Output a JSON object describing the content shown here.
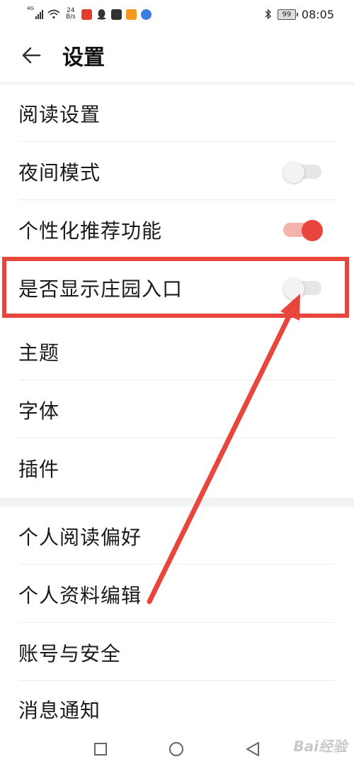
{
  "status_bar": {
    "network_type": "4G",
    "net_speed_value": "24",
    "net_speed_unit": "B/s",
    "battery": "99",
    "time": "08:05"
  },
  "header": {
    "title": "设置"
  },
  "settings": {
    "group1": [
      {
        "label": "阅读设置"
      },
      {
        "label": "夜间模式",
        "toggle": "off"
      },
      {
        "label": "个性化推荐功能",
        "toggle": "on"
      },
      {
        "label": "是否显示庄园入口",
        "toggle": "off"
      },
      {
        "label": "主题"
      },
      {
        "label": "字体"
      },
      {
        "label": "插件"
      }
    ],
    "group2": [
      {
        "label": "个人阅读偏好"
      },
      {
        "label": "个人资料编辑"
      },
      {
        "label": "账号与安全"
      },
      {
        "label": "消息通知"
      }
    ]
  },
  "annotation": {
    "color": "#e8453c"
  },
  "colors": {
    "accent": "#e8453c",
    "toggle_on_track": "#f4b4ac",
    "toggle_off_track": "#e6e6e6"
  },
  "nav_icons": [
    "square-recent-apps-icon",
    "circle-home-icon",
    "triangle-back-icon"
  ],
  "watermark": "Bai经验"
}
